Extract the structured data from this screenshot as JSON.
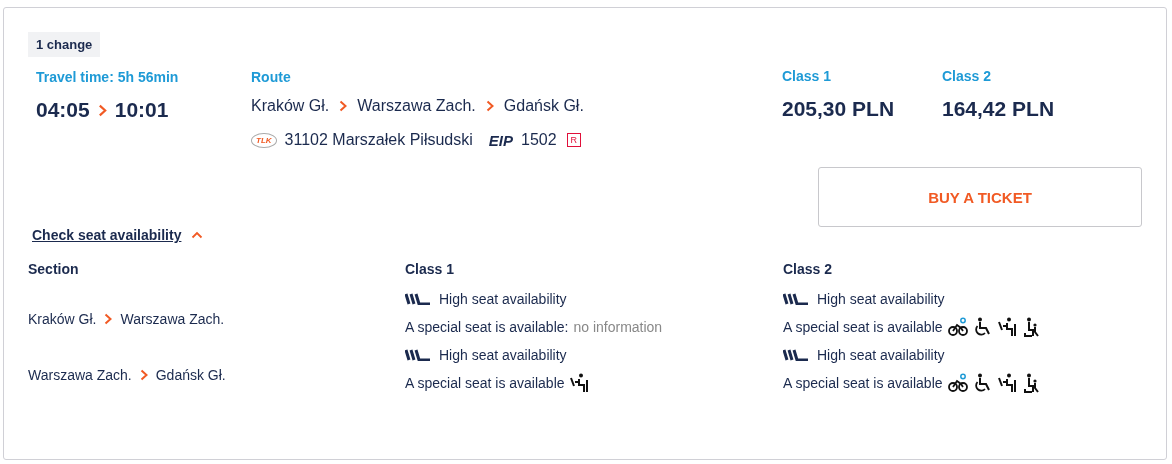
{
  "changes_badge": "1 change",
  "travel_time": "Travel time: 5h 56min",
  "departure": "04:05",
  "arrival": "10:01",
  "route": {
    "heading": "Route",
    "stations": [
      "Kraków Gł.",
      "Warszawa Zach.",
      "Gdańsk Gł."
    ],
    "trains": [
      {
        "carrier": "TLK",
        "kind": "tlk",
        "number": "31102 Marszałek Piłsudski"
      },
      {
        "carrier": "EIP",
        "kind": "eip",
        "number": "1502",
        "reservation": "R"
      }
    ]
  },
  "prices": [
    {
      "label": "Class 1",
      "amount": "205,30 PLN"
    },
    {
      "label": "Class 2",
      "amount": "164,42 PLN"
    }
  ],
  "buy_button": "BUY A TICKET",
  "seat_toggle": {
    "label": "Check seat availability",
    "expanded": true
  },
  "seat_table": {
    "columns": [
      "Section",
      "Class 1",
      "Class 2"
    ],
    "rows": [
      {
        "from": "Kraków Gł.",
        "to": "Warszawa Zach.",
        "classes": [
          {
            "availability": "High seat availability",
            "special": "A special seat is available:",
            "special_note": "no information"
          },
          {
            "availability": "High seat availability",
            "special": "A special seat is available",
            "specials": [
              {
                "kind": "bike"
              },
              {
                "kind": "wheelchair"
              },
              {
                "kind": "table"
              },
              {
                "kind": "child"
              }
            ]
          }
        ]
      },
      {
        "from": "Warszawa Zach.",
        "to": "Gdańsk Gł.",
        "classes": [
          {
            "availability": "High seat availability",
            "special": "A special seat is available",
            "specials": [
              {
                "kind": "table"
              }
            ]
          },
          {
            "availability": "High seat availability",
            "special": "A special seat is available",
            "specials": [
              {
                "kind": "bike"
              },
              {
                "kind": "wheelchair"
              },
              {
                "kind": "table"
              },
              {
                "kind": "child"
              }
            ]
          }
        ]
      }
    ]
  }
}
